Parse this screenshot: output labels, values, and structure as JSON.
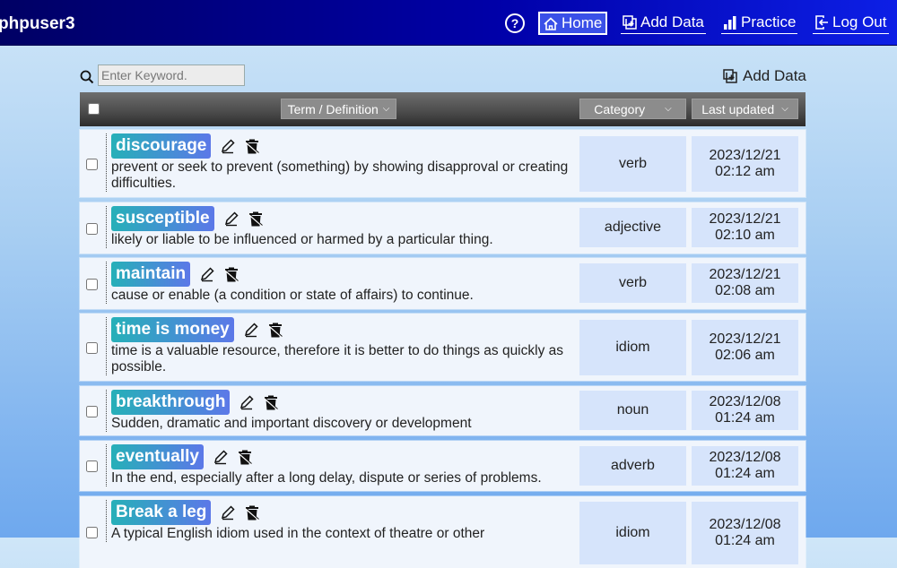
{
  "app": {
    "username": "phpuser3",
    "help_symbol": "?"
  },
  "nav": {
    "home": "Home",
    "add_data": "Add Data",
    "practice": "Practice",
    "log_out": "Log Out"
  },
  "search": {
    "placeholder": "Enter Keyword.",
    "value": ""
  },
  "toolbar": {
    "add_data": "Add Data"
  },
  "table": {
    "headers": {
      "term": "Term / Definition",
      "category": "Category",
      "updated": "Last updated"
    },
    "rows": [
      {
        "term": "discourage",
        "definition": "prevent or seek to prevent (something) by showing disapproval or creating difficulties.",
        "category": "verb",
        "date": "2023/12/21",
        "time": "02:12 am"
      },
      {
        "term": "susceptible",
        "definition": "likely or liable to be influenced or harmed by a particular thing.",
        "category": "adjective",
        "date": "2023/12/21",
        "time": "02:10 am"
      },
      {
        "term": "maintain",
        "definition": "cause or enable (a condition or state of affairs) to continue.",
        "category": "verb",
        "date": "2023/12/21",
        "time": "02:08 am"
      },
      {
        "term": "time is money",
        "definition": "time is a valuable resource, therefore it is better to do things as quickly as possible.",
        "category": "idiom",
        "date": "2023/12/21",
        "time": "02:06 am"
      },
      {
        "term": "breakthrough",
        "definition": "Sudden, dramatic and important discovery or development",
        "category": "noun",
        "date": "2023/12/08",
        "time": "01:24 am"
      },
      {
        "term": "eventually",
        "definition": "In the end, especially after a long delay, dispute or series of problems.",
        "category": "adverb",
        "date": "2023/12/08",
        "time": "01:24 am"
      },
      {
        "term": "Break a leg",
        "definition": "A typical English idiom used in the context of theatre or other",
        "category": "idiom",
        "date": "2023/12/08",
        "time": "01:24 am"
      }
    ]
  },
  "colors": {
    "topbar_start": "#000064",
    "topbar_end": "#0d1fe6",
    "badge_start": "#26b0b8",
    "badge_end": "#5c78e8",
    "cell_bg": "#d6e4fb"
  },
  "icons": [
    "question-circle-icon",
    "home-icon",
    "add-data-icon",
    "bar-chart-icon",
    "logout-icon",
    "search-icon",
    "edit-pencil-icon",
    "delete-trash-icon",
    "chevron-down-icon"
  ]
}
